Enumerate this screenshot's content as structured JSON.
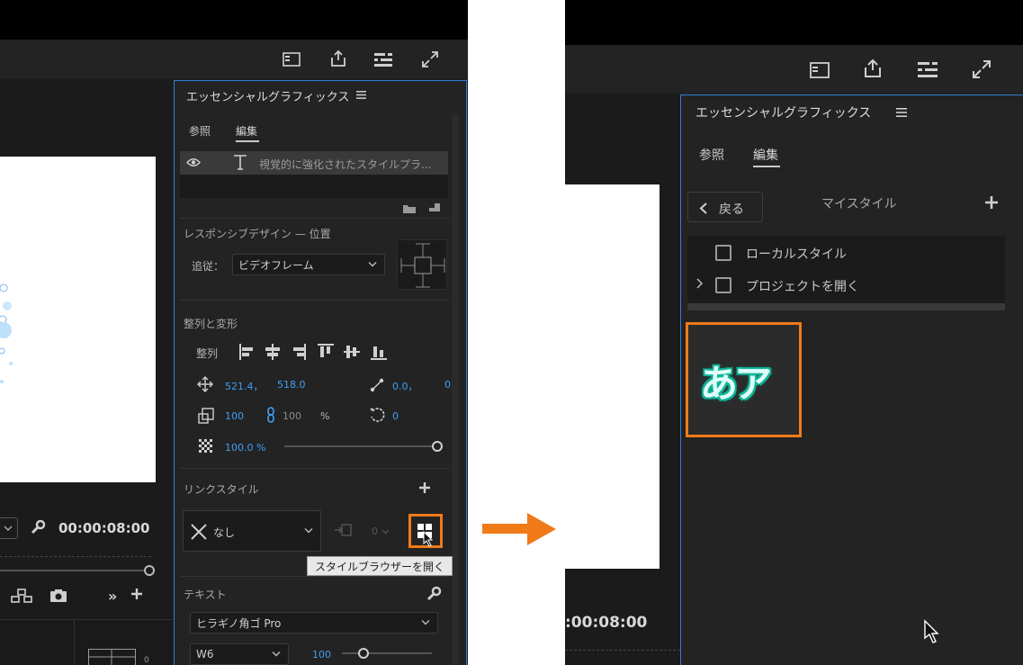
{
  "left": {
    "panel_title": "エッセンシャルグラフィックス",
    "tabs": [
      "参照",
      "編集"
    ],
    "layer_text": "視覚的に強化されたスタイルプラ...",
    "responsive_title": "レスポンシブデザイン — 位置",
    "follow_label": "追従：",
    "follow_value": "ビデオフレーム",
    "align_title": "整列と変形",
    "align_label": "整列",
    "position_x": "521.4，",
    "position_y": "518.0",
    "anchor_x": "0.0，",
    "anchor_y": "0",
    "scale": "100",
    "scale_linked": "100",
    "percent": "%",
    "rotation": "0",
    "opacity": "100.0 %",
    "opacity_level": 1.0,
    "link_style_title": "リンクスタイル",
    "style_none": "なし",
    "style_count": "0",
    "tooltip": "スタイルブラウザーを開く",
    "timecode": "00:00:08:00",
    "text_title": "テキスト",
    "font_family": "ヒラギノ角ゴ Pro",
    "font_weight": "W6",
    "font_size": "100",
    "ruler_zero": "0"
  },
  "right": {
    "panel_title": "エッセンシャルグラフィックス",
    "tabs": [
      "参照",
      "編集"
    ],
    "back_label": "戻る",
    "my_style": "マイスタイル",
    "local_style": "ローカルスタイル",
    "open_project": "プロジェクトを開く",
    "preview_text": "あア",
    "timecode": ":00:08:00"
  },
  "colors": {
    "accent_blue": "#3f9ff5",
    "highlight_orange": "#f07a18",
    "panel_border": "#2f80d7"
  },
  "icons": [
    "panel-icon",
    "export-icon",
    "settings-icon",
    "fullscreen-icon",
    "menu-icon",
    "eye-icon",
    "text-layer-icon",
    "folder-icon",
    "new-item-icon",
    "move-icon",
    "anchor-icon",
    "scale-icon",
    "link-icon",
    "rotate-icon",
    "opacity-icon",
    "plus-icon",
    "x-icon",
    "sync-icon",
    "grid-icon",
    "wrench-icon",
    "camera-icon",
    "chevron-icon",
    "cursor-icon",
    "arrow-right-icon"
  ]
}
